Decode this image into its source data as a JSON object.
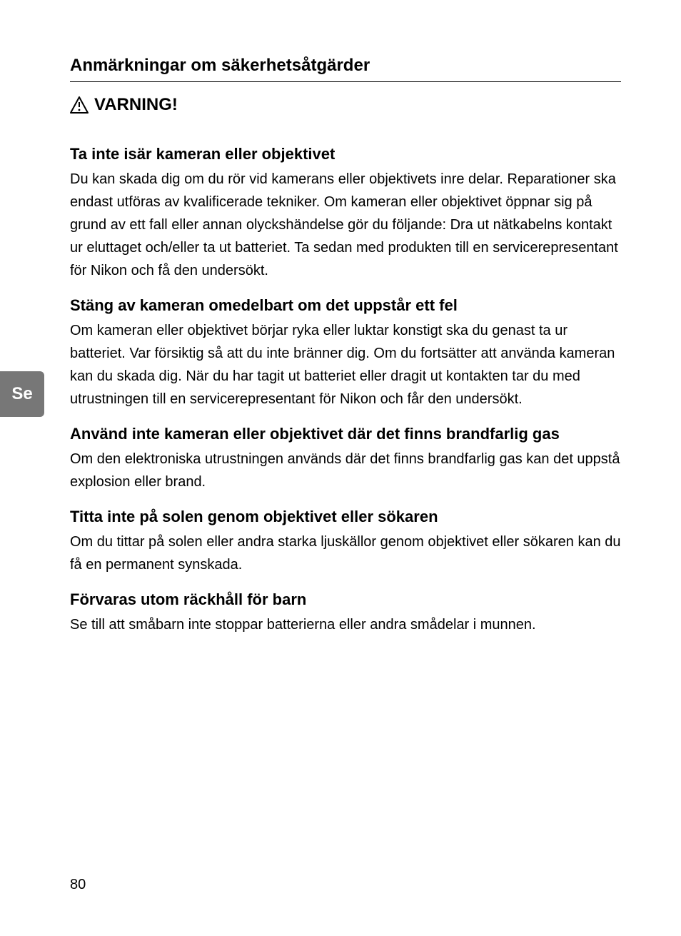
{
  "section_title": "Anmärkningar om säkerhetsåtgärder",
  "warning_label": "VARNING!",
  "lang_tab": "Se",
  "page_number": "80",
  "blocks": [
    {
      "heading": "Ta inte isär kameran eller objektivet",
      "body": "Du kan skada dig om du rör vid kamerans eller objektivets inre delar. Reparationer ska endast utföras av kvalificerade tekniker. Om kameran eller objektivet öppnar sig på grund av ett fall eller annan olyckshändelse gör du följande: Dra ut nätkabelns kontakt ur eluttaget och/eller ta ut batteriet. Ta sedan med produkten till en servicerepresentant för Nikon och få den undersökt."
    },
    {
      "heading": "Stäng av kameran omedelbart om det uppstår ett fel",
      "body": "Om kameran eller objektivet börjar ryka eller luktar konstigt ska du genast ta ur batteriet. Var försiktig så att du inte bränner dig. Om du fortsätter att använda kameran kan du skada dig. När du har tagit ut batteriet eller dragit ut kontakten tar du med utrustningen till en servicerepresentant för Nikon och får den undersökt."
    },
    {
      "heading": "Använd inte kameran eller objektivet där det finns brandfarlig gas",
      "body": "Om den elektroniska utrustningen används där det finns brandfarlig gas kan det uppstå explosion eller brand."
    },
    {
      "heading": "Titta inte på solen genom objektivet eller sökaren",
      "body": "Om du tittar på solen eller andra starka ljuskällor genom objektivet eller sökaren kan du få en permanent synskada."
    },
    {
      "heading": "Förvaras utom räckhåll för barn",
      "body": "Se till att småbarn inte stoppar batterierna eller andra smådelar i munnen."
    }
  ]
}
